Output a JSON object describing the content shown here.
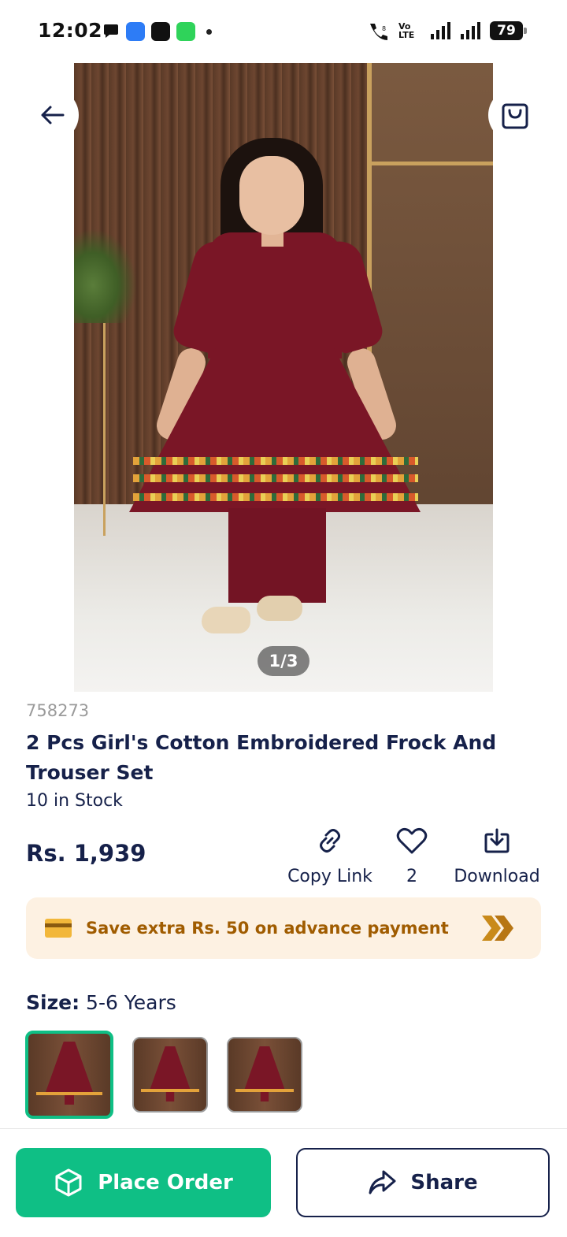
{
  "status_bar": {
    "time": "12:02",
    "battery": "79",
    "network_label": "Vo LTE"
  },
  "gallery": {
    "counter": "1/3",
    "dress_color": "#7a1626"
  },
  "product": {
    "sku": "758273",
    "title": "2 Pcs Girl's Cotton Embroidered Frock And Trouser Set",
    "stock": "10 in Stock",
    "price": "Rs. 1,939"
  },
  "actions": {
    "copy_link": "Copy Link",
    "likes": "2",
    "download": "Download"
  },
  "promo": {
    "text": "Save extra Rs. 50 on advance payment"
  },
  "size": {
    "label": "Size:",
    "value": "5-6 Years"
  },
  "buttons": {
    "place_order": "Place Order",
    "share": "Share"
  },
  "colors": {
    "primary": "#0fbf85",
    "navy": "#16214a",
    "promo_text": "#a05c00"
  }
}
